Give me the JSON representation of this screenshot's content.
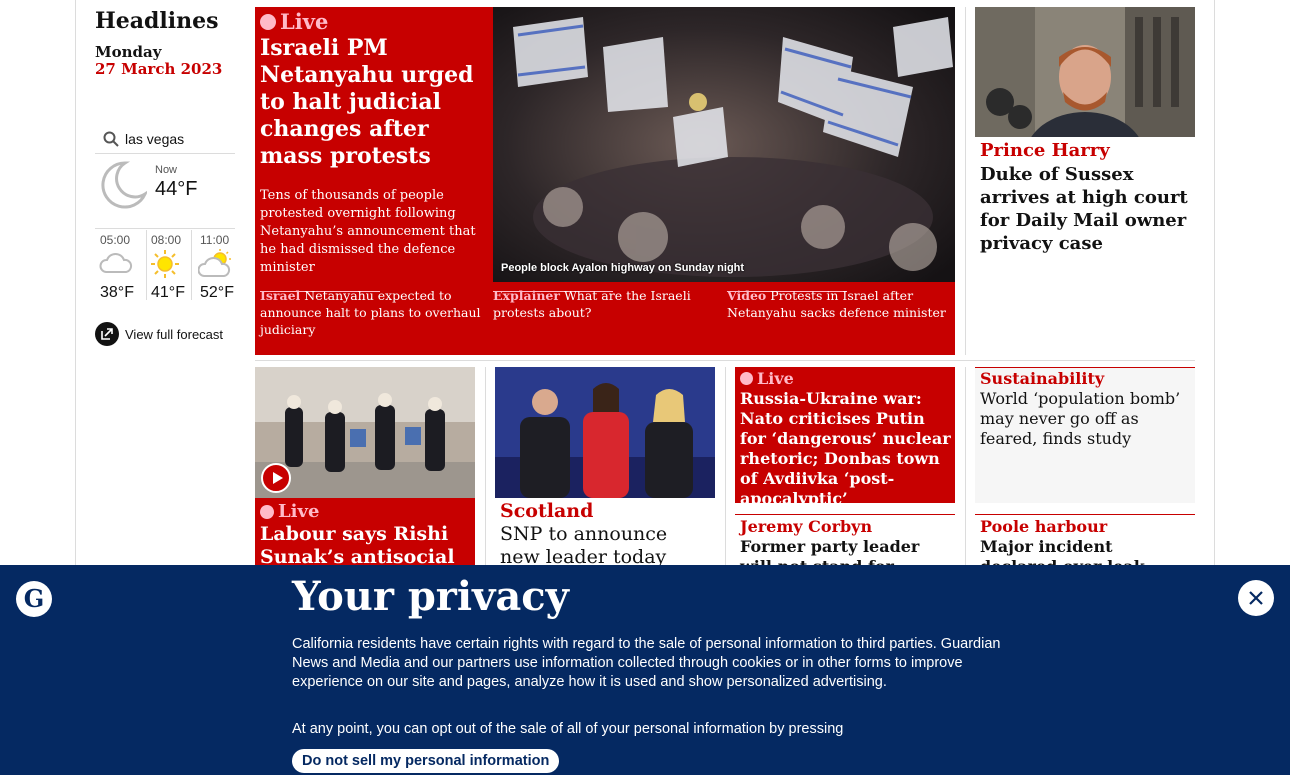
{
  "sidebar": {
    "title": "Headlines",
    "day": "Monday",
    "date": "27 March 2023",
    "location": "las vegas",
    "now_label": "Now",
    "now_temp": "44°F",
    "forecast": [
      {
        "time": "05:00",
        "temp": "38°F",
        "icon": "cloud-icon"
      },
      {
        "time": "08:00",
        "temp": "41°F",
        "icon": "sun-icon"
      },
      {
        "time": "11:00",
        "temp": "52°F",
        "icon": "sun-cloud-icon"
      }
    ],
    "view_forecast": "View full forecast"
  },
  "lead": {
    "live": "Live",
    "headline": "Israeli PM Netanyahu urged to halt judicial changes after mass protests",
    "standfirst": "Tens of thousands of people protested overnight following Netanyahu’s announcement that he had dismissed the defence minister",
    "caption": "People block Ayalon highway on Sunday night",
    "sublinks": [
      {
        "kicker": "Israel",
        "text": "Netanyahu expected to announce halt to plans to overhaul judiciary"
      },
      {
        "kicker": "Explainer",
        "text": "What are the Israeli protests about?"
      },
      {
        "kicker": "Video",
        "text": "Protests in Israel after Netanyahu sacks defence minister"
      }
    ]
  },
  "harry": {
    "kicker": "Prince Harry",
    "headline": "Duke of Sussex arrives at high court for Daily Mail owner privacy case"
  },
  "labour": {
    "live": "Live",
    "headline": "Labour says Rishi Sunak’s antisocial"
  },
  "snp": {
    "kicker": "Scotland",
    "headline": "SNP to announce new leader today"
  },
  "ukraine": {
    "live": "Live",
    "headline": "Russia-Ukraine war: Nato criticises Putin for ‘dangerous’ nuclear rhetoric; Donbas town of Avdiivka ‘post-apocalyptic’"
  },
  "sustainability": {
    "kicker": "Sustainability",
    "headline": "World ‘population bomb’ may never go off as feared, finds study"
  },
  "corbyn": {
    "kicker": "Jeremy Corbyn",
    "headline": "Former party leader will not stand for Labour at"
  },
  "poole": {
    "kicker": "Poole harbour",
    "headline": "Major incident declared over leak from oil field"
  },
  "privacy": {
    "title": "Your privacy",
    "text": "California residents have certain rights with regard to the sale of personal information to third parties. Guardian News and Media and our partners use information collected through cookies or in other forms to improve experience on our site and pages, analyze how it is used and show personalized advertising.",
    "text2": "At any point, you can opt out of the sale of all of your personal information by pressing",
    "button": "Do not sell my personal information"
  },
  "colors": {
    "accent": "#c70000",
    "live_pink": "#ffbac8",
    "banner": "#052962"
  }
}
